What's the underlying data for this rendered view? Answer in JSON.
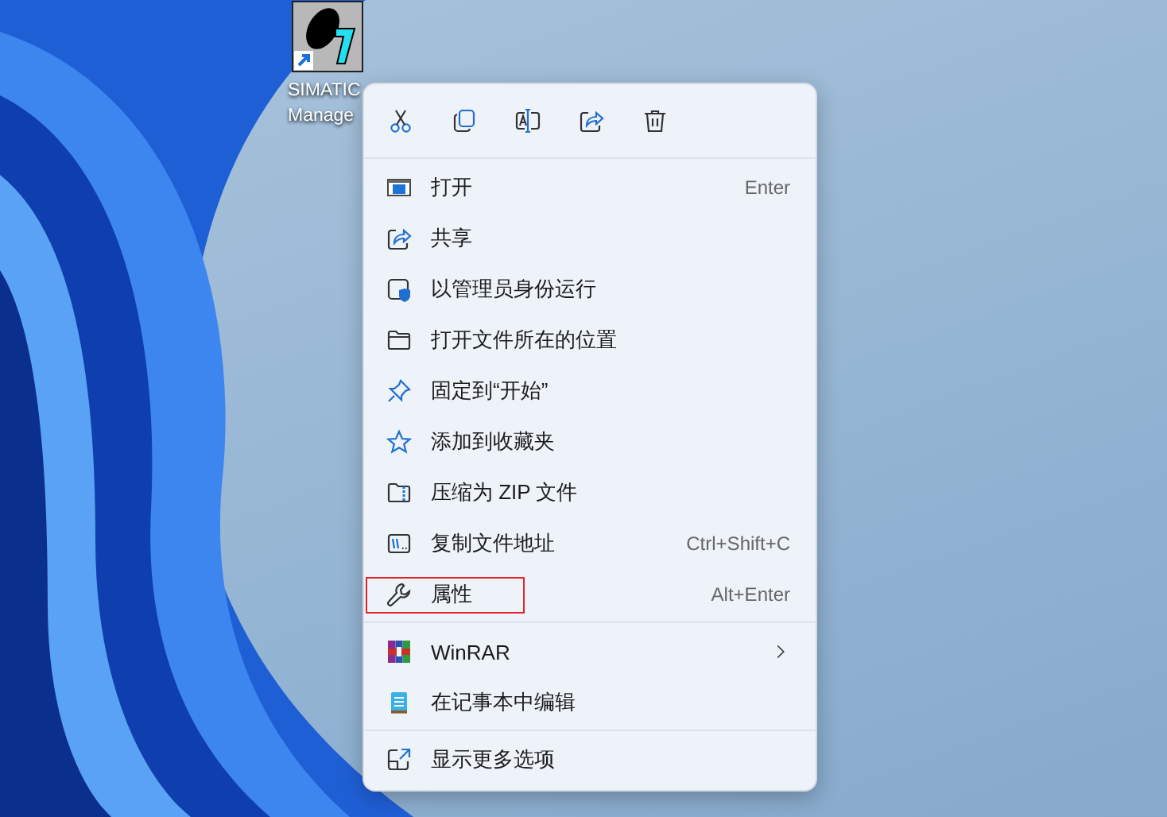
{
  "desktop_icon": {
    "label_lines": [
      "SIMATIC",
      "Manage"
    ]
  },
  "context_menu": {
    "sections": [
      {
        "items": [
          {
            "label": "打开",
            "shortcut": "Enter",
            "submenu": false,
            "highlighted": false
          },
          {
            "label": "共享",
            "submenu": false,
            "highlighted": false
          },
          {
            "label": "以管理员身份运行",
            "submenu": false,
            "highlighted": false
          },
          {
            "label": "打开文件所在的位置",
            "submenu": false,
            "highlighted": false
          },
          {
            "label": "固定到“开始”",
            "submenu": false,
            "highlighted": false
          },
          {
            "label": "添加到收藏夹",
            "submenu": false,
            "highlighted": false
          },
          {
            "label": "压缩为 ZIP 文件",
            "submenu": false,
            "highlighted": false
          },
          {
            "label": "复制文件地址",
            "shortcut": "Ctrl+Shift+C",
            "submenu": false,
            "highlighted": false
          },
          {
            "label": "属性",
            "shortcut": "Alt+Enter",
            "submenu": false,
            "highlighted": true
          }
        ]
      },
      {
        "items": [
          {
            "label": "WinRAR",
            "submenu": true,
            "highlighted": false
          },
          {
            "label": "在记事本中编辑",
            "submenu": false,
            "highlighted": false
          }
        ]
      },
      {
        "items": [
          {
            "label": "显示更多选项",
            "submenu": false,
            "highlighted": false
          }
        ]
      }
    ]
  }
}
